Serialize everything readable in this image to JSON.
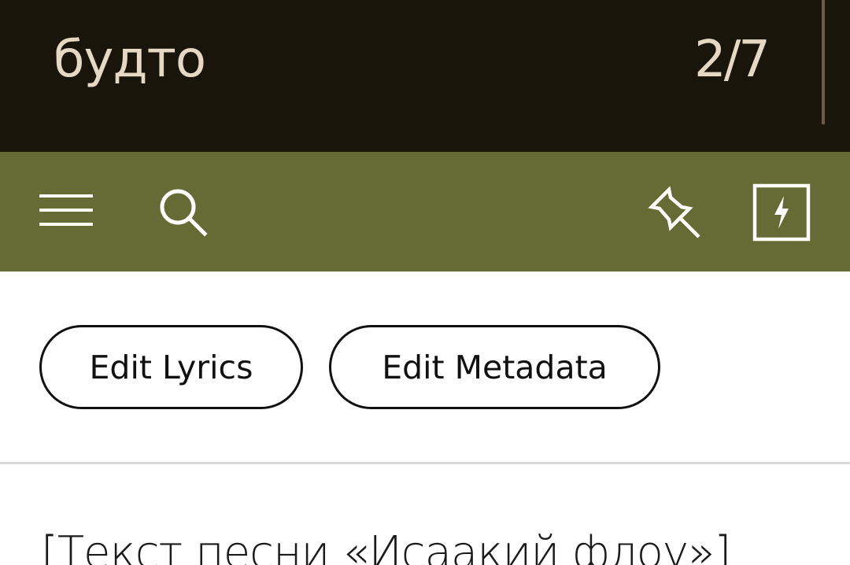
{
  "find_bar": {
    "query": "будто",
    "match_count": "2/7"
  },
  "toolbar": {
    "icons": [
      "menu-icon",
      "search-icon",
      "pin-icon",
      "bolt-icon"
    ],
    "background_color": "#646b34"
  },
  "actions": {
    "edit_lyrics_label": "Edit Lyrics",
    "edit_metadata_label": "Edit Metadata"
  },
  "lyrics": {
    "header": "[Текст песни «Исаакий флоу»]"
  },
  "colors": {
    "find_bar_bg": "#1a150b",
    "find_text": "#e6d9c3",
    "toolbar_bg": "#646b34",
    "icon": "#ffffff"
  }
}
